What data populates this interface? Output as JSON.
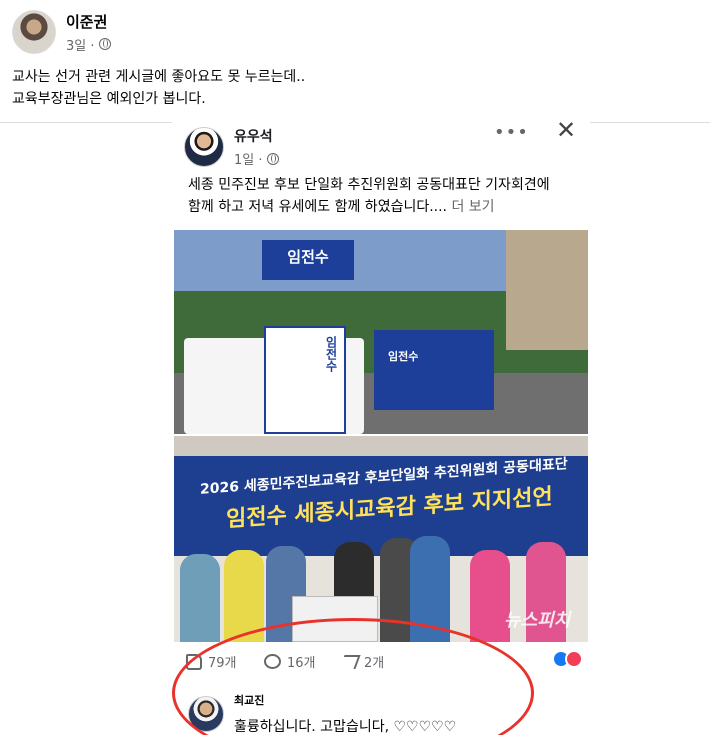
{
  "post": {
    "author": "이준권",
    "time": "3일 ·",
    "lines": [
      "교사는 선거 관련 게시글에 좋아요도 못 누르는데..",
      "교육부장관님은 예외인가 봅니다."
    ]
  },
  "shared": {
    "author": "유우석",
    "time": "1일 ·",
    "more": "•••",
    "close": "✕",
    "lines": [
      "세종 민주진보 후보 단일화 추진위원회 공동대표단 기자회견에",
      "함께 하고 저녁 유세에도 함께 하였습니다...."
    ],
    "see_more": "더 보기",
    "photo1": {
      "banner": "임전수",
      "poster": "임전수",
      "stage_label": "임전수"
    },
    "photo2": {
      "headline1": "2026 세종민주진보교육감 후보단일화 추진위원회 공동대표단",
      "headline2": "임전수 세종시교육감 후보 지지선언",
      "watermark": "뉴스피치"
    },
    "actions": {
      "likes": "79개",
      "comments": "16개",
      "shares": "2개"
    },
    "comment": {
      "author": "최교진",
      "text": "훌륭하십니다. 고맙습니다, ♡♡♡♡♡"
    }
  },
  "colors": {
    "like_blue": "#1877f2",
    "love_red": "#f33e58",
    "highlight_circle": "#e8322b",
    "banner_blue": "#1d3f9a"
  }
}
